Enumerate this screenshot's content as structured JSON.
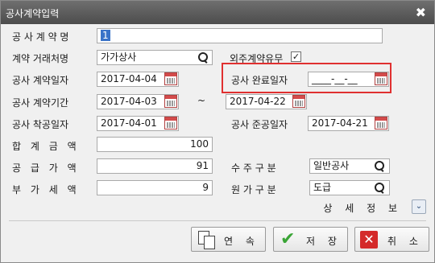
{
  "window": {
    "title": "공사계약입력",
    "close": "✖"
  },
  "form": {
    "contract_name_label": "공 사 계 약 명",
    "contract_name_value": "1",
    "client_label": "계약 거래처명",
    "client_value": "가가상사",
    "outsourcing_label": "외주계약유무",
    "outsourcing_checked": "✓",
    "contract_date_label": "공사 계약일자",
    "contract_date_value": "2017-04-04",
    "completion_date_label": "공사 완료일자",
    "completion_date_value": "____-__-__",
    "period_label": "공사 계약기간",
    "period_from": "2017-04-03",
    "period_sep": "~",
    "period_to": "2017-04-22",
    "start_date_label": "공사 착공일자",
    "start_date_value": "2017-04-01",
    "finish_date_label": "공사 준공일자",
    "finish_date_value": "2017-04-21",
    "total_label": "합 계 금 액",
    "total_value": "100",
    "supply_label": "공 급 가 액",
    "supply_value": "91",
    "vat_label": "부 가 세 액",
    "vat_value": "9",
    "order_type_label": "수 주 구 분",
    "order_type_value": "일반공사",
    "cost_type_label": "원 가 구 분",
    "cost_type_value": "도급"
  },
  "detail": {
    "label": "상 세 정 보",
    "toggle": "⌄"
  },
  "buttons": {
    "continuous": "연 속",
    "save": "저 장",
    "cancel": "취 소"
  }
}
